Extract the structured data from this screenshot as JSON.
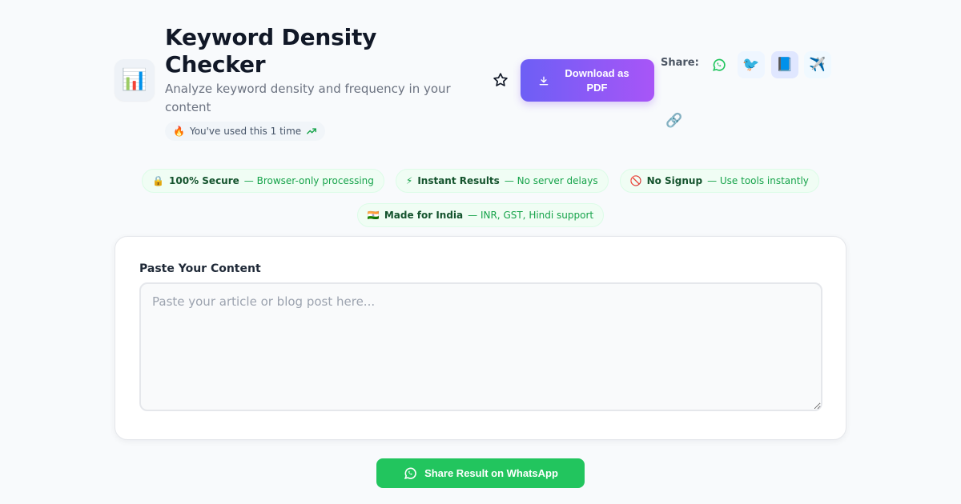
{
  "header": {
    "title": "Keyword Density Checker",
    "subtitle": "Analyze keyword density and frequency in your content",
    "usage": {
      "emoji": "🔥",
      "text": "You've used this 1 time"
    },
    "download_label": "Download as PDF",
    "share_label": "Share:",
    "share_icons": {
      "whatsapp": "whatsapp-icon",
      "twitter": "🐦",
      "facebook": "📘",
      "telegram": "✈️",
      "link": "🔗"
    },
    "tool_icon": "📊"
  },
  "trust": [
    {
      "emoji": "🔒",
      "title": "100% Secure",
      "desc": "— Browser-only processing"
    },
    {
      "emoji": "⚡",
      "title": "Instant Results",
      "desc": "— No server delays"
    },
    {
      "emoji": "🚫",
      "title": "No Signup",
      "desc": "— Use tools instantly"
    },
    {
      "emoji": "🇮🇳",
      "title": "Made for India",
      "desc": "— INR, GST, Hindi support"
    }
  ],
  "content": {
    "label": "Paste Your Content",
    "placeholder": "Paste your article or blog post here...",
    "value": ""
  },
  "whatsapp_share_label": "Share Result on WhatsApp",
  "colors": {
    "accent_start": "#6d5ff5",
    "accent_end": "#a855f7",
    "whatsapp": "#22c55e",
    "trust_text": "#16a34a"
  }
}
